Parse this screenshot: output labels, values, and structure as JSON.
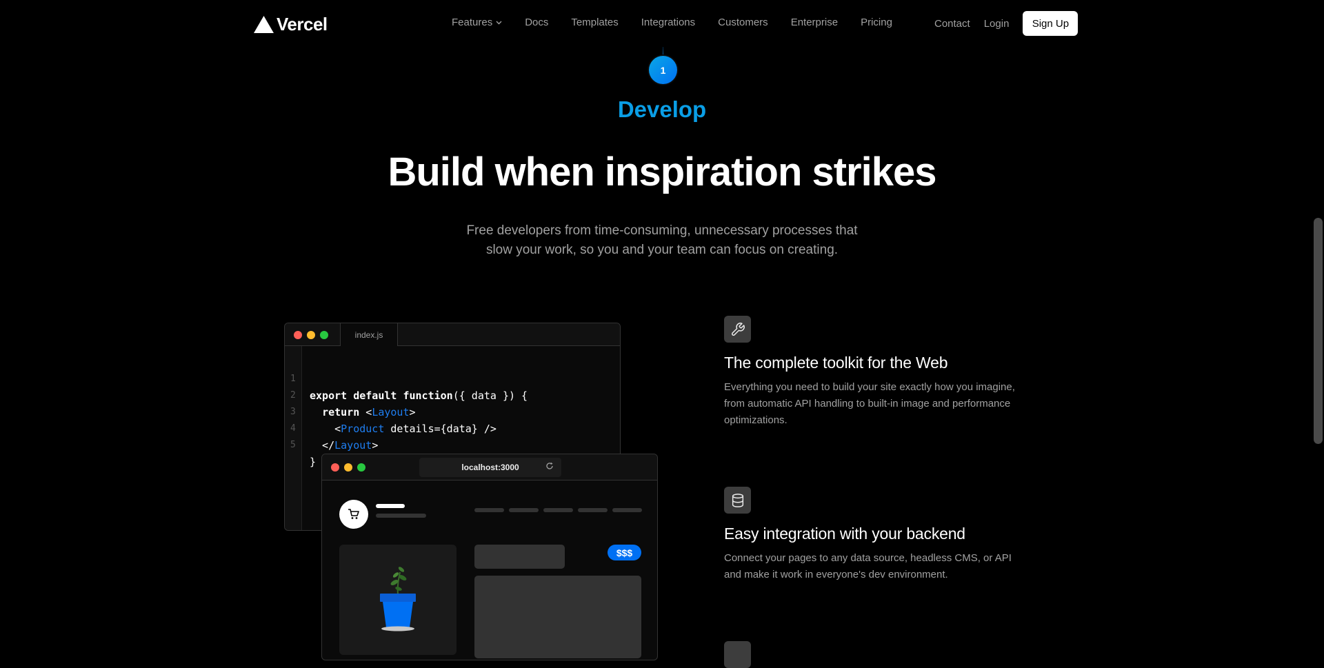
{
  "nav": {
    "logo_text": "Vercel",
    "links": [
      {
        "label": "Features",
        "has_dropdown": true
      },
      {
        "label": "Docs"
      },
      {
        "label": "Templates"
      },
      {
        "label": "Integrations"
      },
      {
        "label": "Customers"
      },
      {
        "label": "Enterprise"
      },
      {
        "label": "Pricing"
      }
    ],
    "contact": "Contact",
    "login": "Login",
    "signup": "Sign Up"
  },
  "hero": {
    "step_number": "1",
    "step_label": "Develop",
    "headline": "Build when inspiration strikes",
    "subtext_line1": "Free developers from time-consuming, unnecessary processes that",
    "subtext_line2": "slow your work, so you and your team can focus on creating."
  },
  "editor": {
    "tab": "index.js",
    "lines": [
      {
        "n": "1"
      },
      {
        "n": "2"
      },
      {
        "n": "3"
      },
      {
        "n": "4"
      },
      {
        "n": "5"
      }
    ]
  },
  "browser": {
    "url": "localhost:3000",
    "price": "$$$"
  },
  "features": [
    {
      "icon": "wrench-icon",
      "title": "The complete toolkit for the Web",
      "desc_line1": "Everything you need to build your site exactly how you imagine,",
      "desc_line2": "from automatic API handling to built-in image and performance",
      "desc_line3": "optimizations."
    },
    {
      "icon": "database-icon",
      "title": "Easy integration with your backend",
      "desc_line1": "Connect your pages to any data source, headless CMS, or API",
      "desc_line2": "and make it work in everyone's dev environment."
    }
  ],
  "colors": {
    "accent_blue": "#0a9ee6",
    "code_tag_blue": "#1f7ef0",
    "price_blue": "#0070f3",
    "muted_text": "#a1a1a1"
  }
}
